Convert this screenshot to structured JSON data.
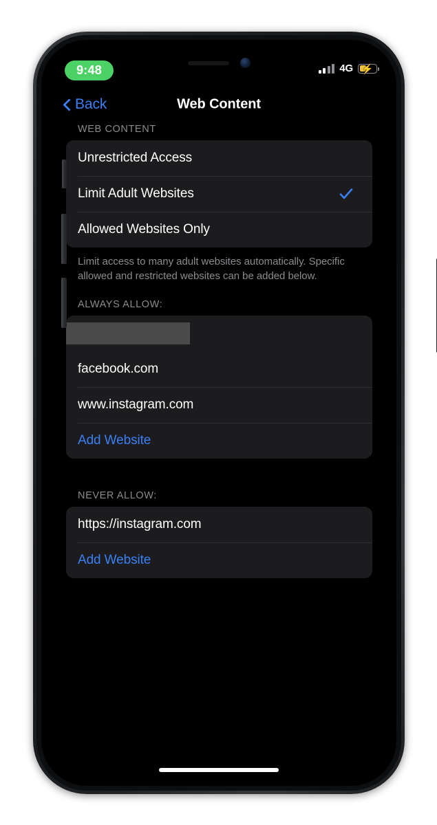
{
  "status_bar": {
    "time": "9:48",
    "network_type": "4G",
    "signal_icon": "cellular-signal-icon",
    "battery_icon": "battery-charging-low-power-icon",
    "battery_bolt": "⚡"
  },
  "nav": {
    "back_label": "Back",
    "back_icon": "chevron-left-icon",
    "title": "Web Content"
  },
  "sections": {
    "web_content": {
      "header": "WEB CONTENT",
      "options": [
        {
          "label": "Unrestricted Access",
          "selected": false
        },
        {
          "label": "Limit Adult Websites",
          "selected": true
        },
        {
          "label": "Allowed Websites Only",
          "selected": false
        }
      ],
      "footer": "Limit access to many adult websites automatically. Specific allowed and restricted websites can be added below."
    },
    "always_allow": {
      "header": "ALWAYS ALLOW:",
      "redacted_row": "",
      "items": [
        "facebook.com",
        "www.instagram.com"
      ],
      "add_label": "Add Website"
    },
    "never_allow": {
      "header": "NEVER ALLOW:",
      "items": [
        "https://instagram.com"
      ],
      "add_label": "Add Website"
    }
  },
  "colors": {
    "accent_blue": "#3b7ff5",
    "status_green": "#4cd264",
    "battery_yellow": "#f2c43b",
    "card_bg": "#1c1c1e",
    "screen_bg": "#000000",
    "secondary_text": "#8b8b90"
  }
}
